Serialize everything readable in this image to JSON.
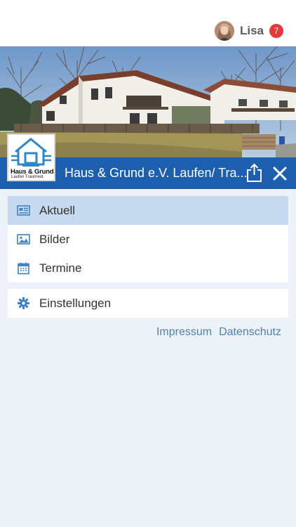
{
  "user": {
    "name": "Lisa",
    "notifications": "7"
  },
  "header": {
    "title": "Haus & Grund e.V. Laufen/ Tra...",
    "logo_title": "Haus & Grund",
    "logo_subtitle": "Laufen Traunreut"
  },
  "menu": {
    "items": [
      {
        "label": "Aktuell",
        "icon": "newspaper-icon",
        "active": true
      },
      {
        "label": "Bilder",
        "icon": "image-icon"
      },
      {
        "label": "Termine",
        "icon": "calendar-icon"
      }
    ],
    "settings": {
      "label": "Einstellungen",
      "icon": "gear-icon"
    }
  },
  "footer": {
    "impressum": "Impressum",
    "datenschutz": "Datenschutz"
  },
  "colors": {
    "accent": "#1d5fae",
    "active_row": "#c6d9ee",
    "badge": "#e23a3a",
    "link": "#4e82a8",
    "background": "#edf1f8"
  }
}
